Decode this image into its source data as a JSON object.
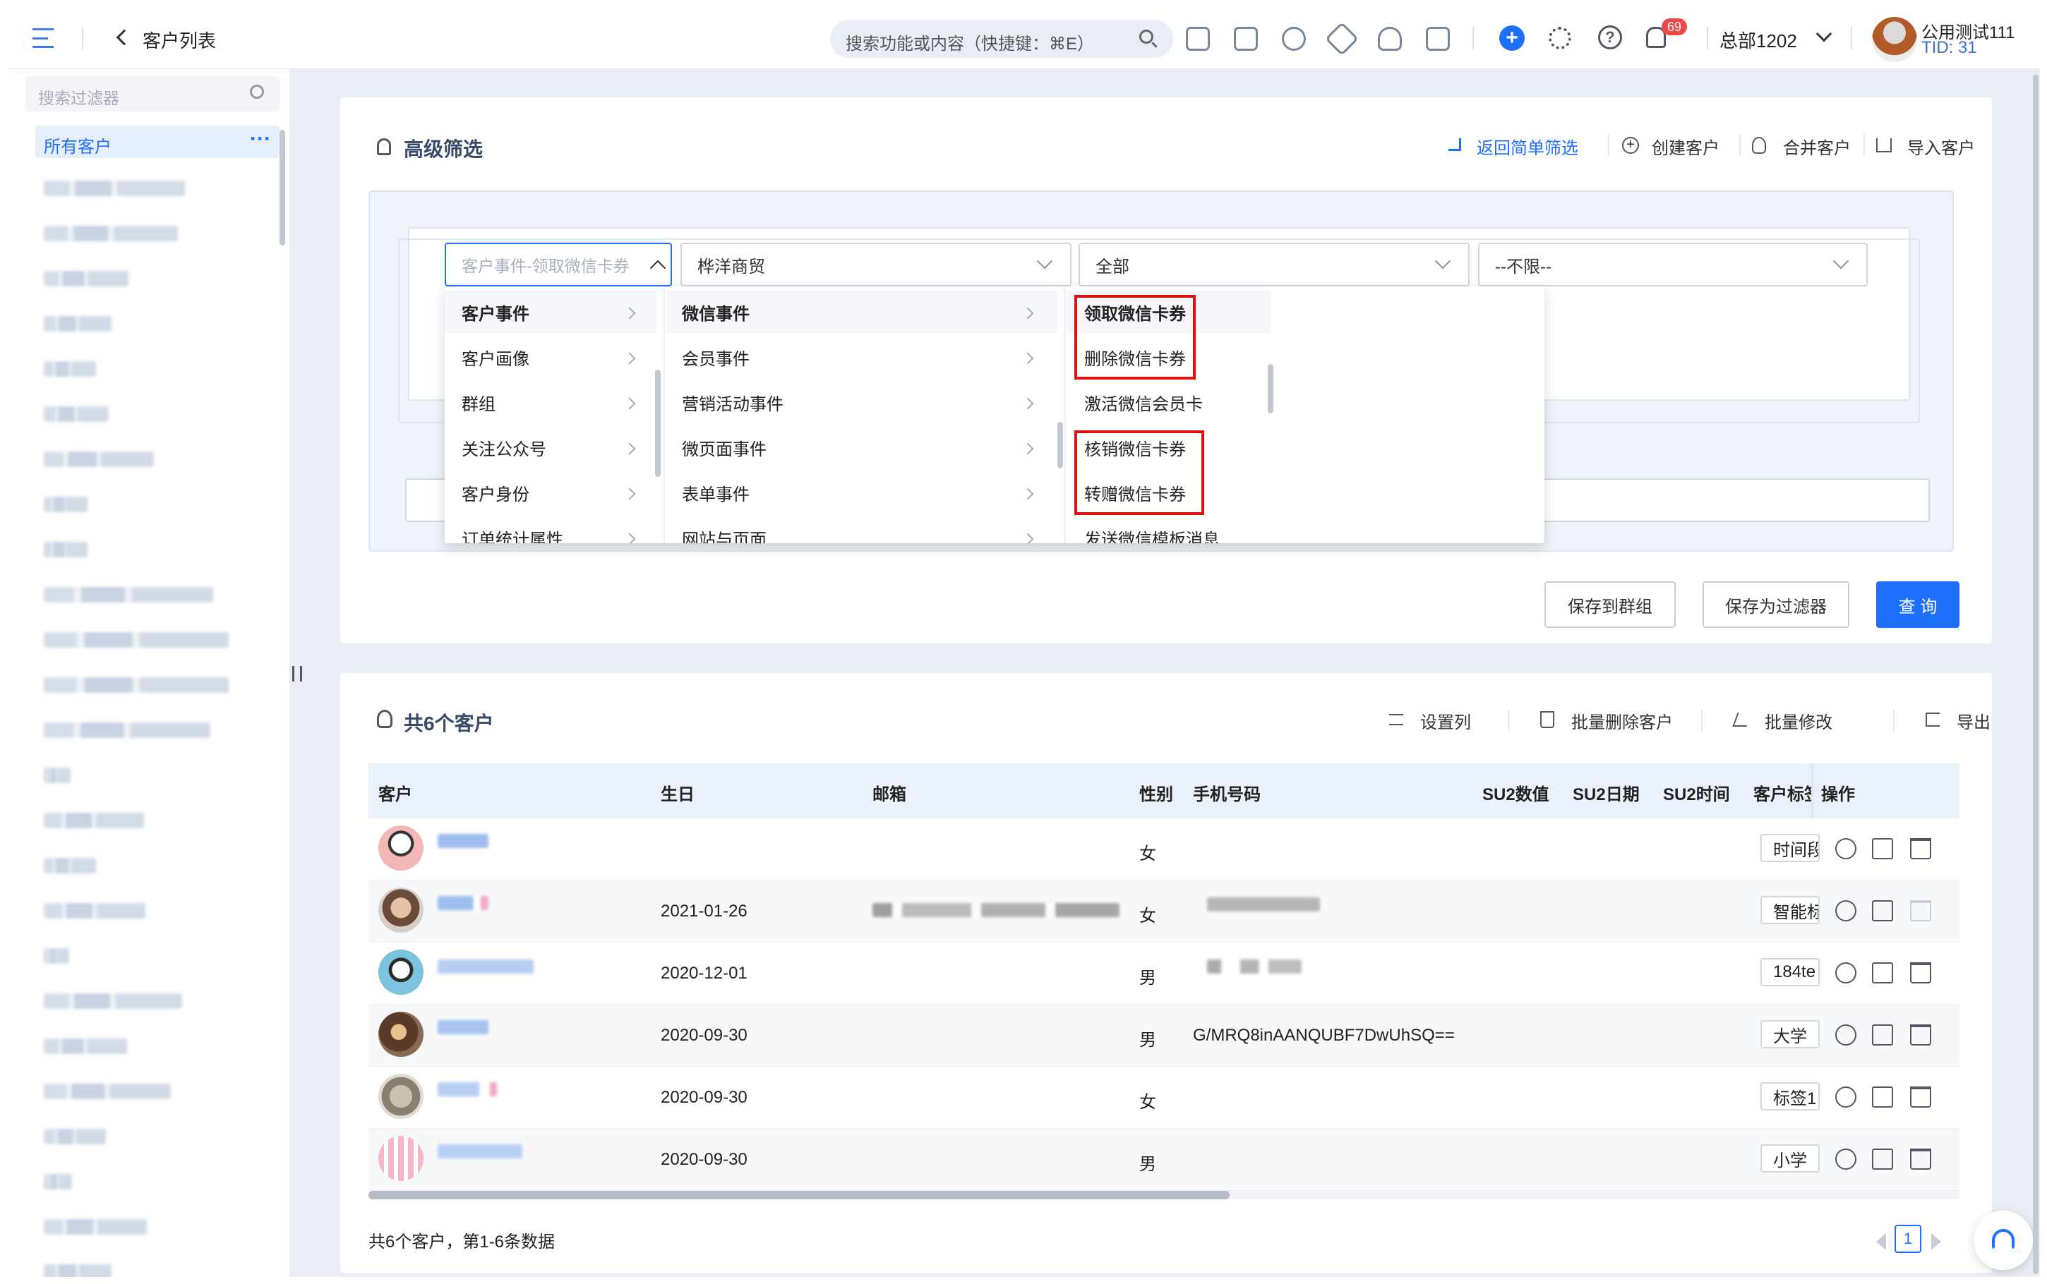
{
  "topbar": {
    "breadcrumb": "客户列表",
    "search_placeholder": "搜索功能或内容（快捷键：⌘E）",
    "notification_count": "69",
    "org": "总部1202",
    "user_name": "公用测试111",
    "tid": "TID: 31"
  },
  "sidebar": {
    "filter_placeholder": "搜索过滤器",
    "selected_item": "所有客户",
    "more": "···"
  },
  "filter": {
    "title": "高级筛选",
    "actions": [
      "返回简单筛选",
      "创建客户",
      "合并客户",
      "导入客户"
    ],
    "select1_placeholder": "客户事件-领取微信卡券",
    "select2": "桦洋商贸",
    "select3": "全部",
    "select4": "--不限--",
    "menu_col1": [
      "客户事件",
      "客户画像",
      "群组",
      "关注公众号",
      "客户身份",
      "订单统计属性"
    ],
    "menu_col2": [
      "微信事件",
      "会员事件",
      "营销活动事件",
      "微页面事件",
      "表单事件",
      "网站与页面"
    ],
    "menu_col3": [
      "领取微信卡券",
      "删除微信卡券",
      "激活微信会员卡",
      "核销微信卡券",
      "转赠微信卡券",
      "发送微信模板消息"
    ],
    "btn_save_group": "保存到群组",
    "btn_save_filter": "保存为过滤器",
    "btn_query": "查 询"
  },
  "table": {
    "title": "共6个客户",
    "actions": [
      "设置列",
      "批量删除客户",
      "批量修改",
      "导出"
    ],
    "columns": [
      "客户",
      "生日",
      "邮箱",
      "性别",
      "手机号码",
      "SU2数值",
      "SU2日期",
      "SU2时间",
      "客户标签",
      "操作"
    ],
    "rows": [
      {
        "birthday": "",
        "gender": "女",
        "phone": "",
        "tag": "时间段"
      },
      {
        "birthday": "2021-01-26",
        "gender": "女",
        "phone": "",
        "tag": "智能标"
      },
      {
        "birthday": "2020-12-01",
        "gender": "男",
        "phone": "",
        "tag": "184te"
      },
      {
        "birthday": "2020-09-30",
        "gender": "男",
        "phone": "G/MRQ8inAANQUBF7DwUhSQ==",
        "tag": "大学"
      },
      {
        "birthday": "2020-09-30",
        "gender": "女",
        "phone": "",
        "tag": "标签1"
      },
      {
        "birthday": "2020-09-30",
        "gender": "男",
        "phone": "",
        "tag": "小学"
      }
    ],
    "footer": "共6个客户，第1-6条数据",
    "page": "1"
  },
  "colors": {
    "accent": "#1f6fff",
    "red_highlight": "#e01010",
    "header_bg": "#eaf1fb"
  },
  "icons": [
    "menu-icon",
    "back-icon",
    "search-icon",
    "bell-icon",
    "settings-icon",
    "help-icon",
    "plus-circle-icon",
    "trash-icon",
    "export-icon",
    "user-icon",
    "filter-icon"
  ]
}
